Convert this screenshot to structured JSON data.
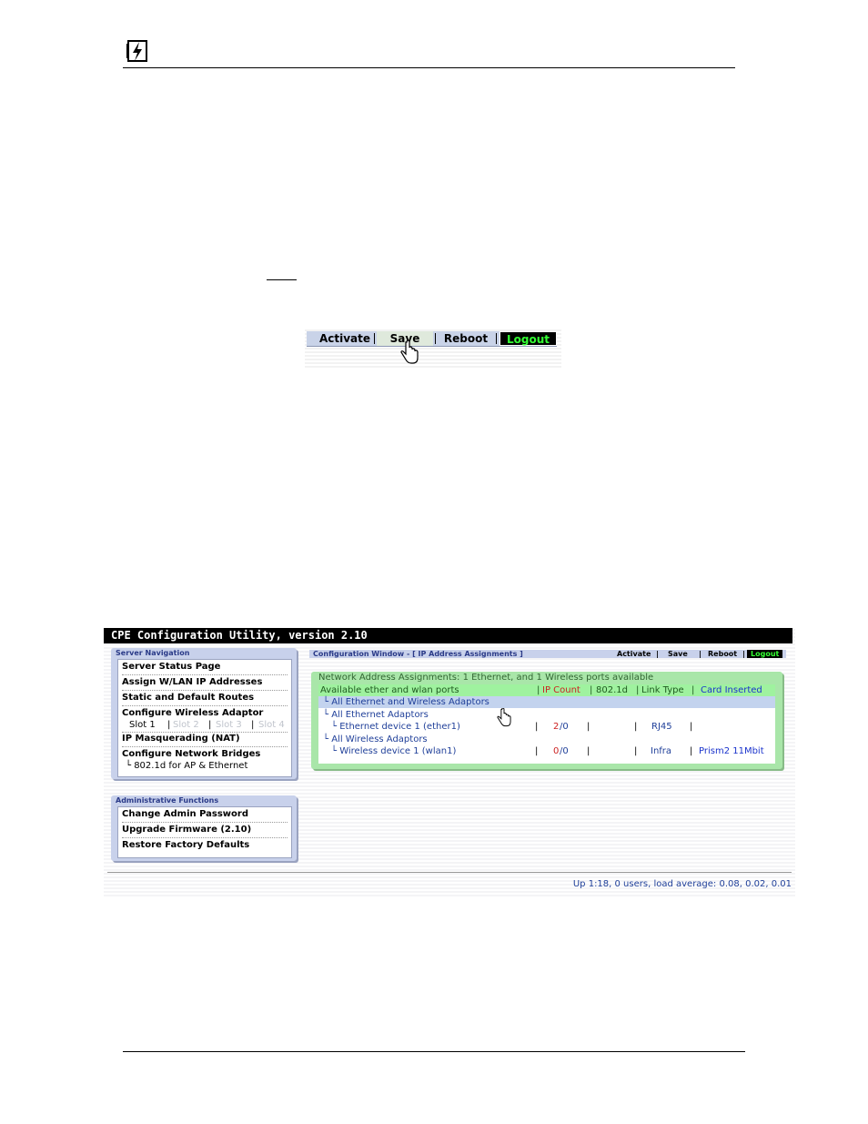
{
  "toolbar_demo": {
    "activate": "Activate",
    "save": "Save",
    "reboot": "Reboot",
    "logout": "Logout"
  },
  "screenshot": {
    "title": "CPE Configuration Utility, version 2.10",
    "server_nav": {
      "title": "Server Navigation",
      "items": [
        "Server Status Page",
        "Assign W/LAN IP Addresses",
        "Static and Default Routes",
        "Configure Wireless Adaptor",
        "IP Masquerading (NAT)",
        "Configure Network Bridges"
      ],
      "slots": [
        "Slot 1",
        "Slot 2",
        "Slot 3",
        "Slot 4"
      ],
      "bridge_sub": "└ 802.1d for AP & Ethernet"
    },
    "admin": {
      "title": "Administrative Functions",
      "items": [
        "Change Admin Password",
        "Upgrade Firmware (2.10)",
        "Restore Factory Defaults"
      ]
    },
    "config_window": {
      "label": "Configuration Window - [ IP Address Assignments ]",
      "activate": "Activate",
      "save": "Save",
      "reboot": "Reboot",
      "logout": "Logout"
    },
    "network": {
      "title": "Network Address Assignments: 1 Ethernet, and 1 Wireless ports available",
      "header": {
        "ports": "Available ether and wlan ports",
        "ip_count": "IP Count",
        "dot1d": "802.1d",
        "link_type": "Link Type",
        "card": "Card Inserted"
      },
      "rows": {
        "all_both": "└ All Ethernet and Wireless Adaptors",
        "all_eth": "└ All Ethernet Adaptors",
        "eth1": "└ Ethernet device 1 (ether1)",
        "eth1_count_used": "2",
        "eth1_count_rest": "/0",
        "eth1_link": "RJ45",
        "all_wlan": "└ All Wireless Adaptors",
        "wlan1": "└ Wireless device 1 (wlan1)",
        "wlan1_count_used": "0",
        "wlan1_count_rest": "/0",
        "wlan1_link": "Infra",
        "wlan1_card": "Prism2 11Mbit"
      },
      "sep": "|"
    },
    "status": "Up 1:18, 0 users, load average: 0.08, 0.02, 0.01"
  },
  "colors": {
    "panel": "#c8d1eb",
    "net_green": "#a9e6a9",
    "logout_green": "#33ff33"
  }
}
